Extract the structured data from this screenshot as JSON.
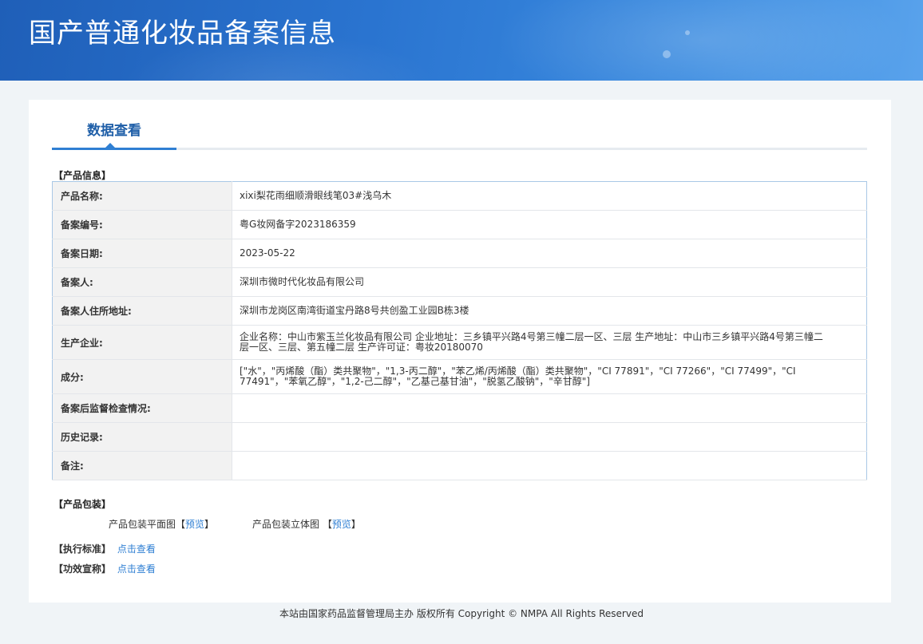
{
  "header": {
    "title": "国产普通化妆品备案信息"
  },
  "tabs": {
    "active_label": "数据查看"
  },
  "product_info": {
    "section_title": "【产品信息】",
    "rows": [
      {
        "key": "产品名称:",
        "value": "xixi梨花雨细顺滑眼线笔03#浅乌木"
      },
      {
        "key": "备案编号:",
        "value": "粤G妆网备字2023186359"
      },
      {
        "key": "备案日期:",
        "value": "2023-05-22"
      },
      {
        "key": "备案人:",
        "value": "深圳市微时代化妆品有限公司"
      },
      {
        "key": "备案人住所地址:",
        "value": "深圳市龙岗区南湾街道宝丹路8号共创盈工业园B栋3楼"
      },
      {
        "key": "生产企业:",
        "value": "企业名称：中山市紫玉兰化妆品有限公司 企业地址：三乡镇平兴路4号第三幢二层一区、三层 生产地址：中山市三乡镇平兴路4号第三幢二层一区、三层、第五幢二层 生产许可证：粤妆20180070"
      },
      {
        "key": "成分:",
        "value": "[\"水\"，\"丙烯酸（酯）类共聚物\"，\"1,3-丙二醇\"，\"苯乙烯/丙烯酸（酯）类共聚物\"，\"CI 77891\"，\"CI 77266\"，\"CI 77499\"，\"CI 77491\"，\"苯氧乙醇\"，\"1,2-己二醇\"，\"乙基己基甘油\"，\"脱氢乙酸钠\"，\"辛甘醇\"]"
      },
      {
        "key": "备案后监督检查情况:",
        "value": ""
      },
      {
        "key": "历史记录:",
        "value": ""
      },
      {
        "key": "备注:",
        "value": ""
      }
    ]
  },
  "packaging": {
    "section_title": "【产品包装】",
    "flat_label": "产品包装平面图",
    "solid_label": "产品包装立体图",
    "bracket_open": "【",
    "bracket_close": "】",
    "preview_label": "预览"
  },
  "standard": {
    "title": "【执行标准】",
    "link": "点击查看"
  },
  "claims": {
    "title": "【功效宣称】",
    "link": "点击查看"
  },
  "footer": {
    "text": "本站由国家药品监督管理局主办 版权所有 Copyright © NMPA All Rights Reserved"
  }
}
